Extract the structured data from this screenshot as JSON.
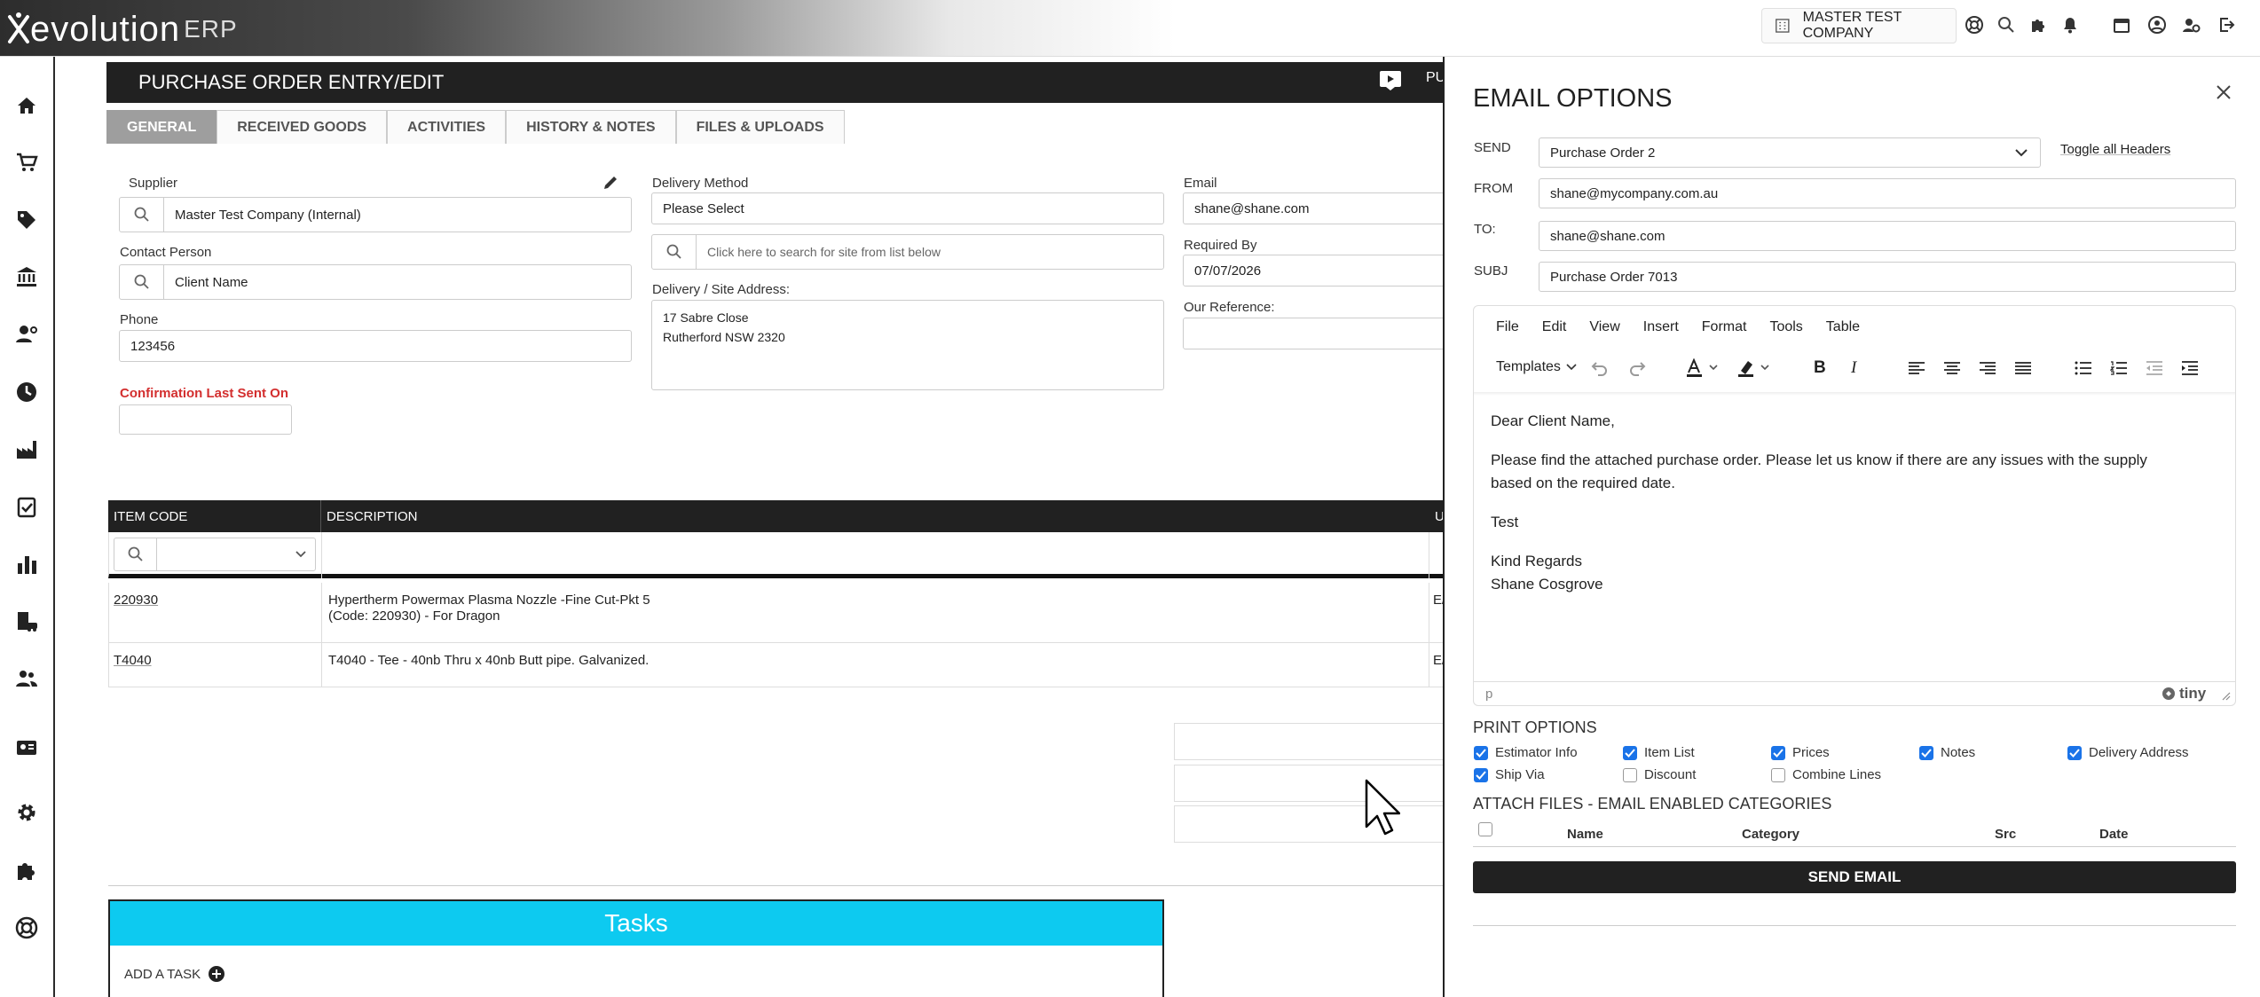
{
  "topbar": {
    "logo_text": "evolution",
    "logo_suffix": "ERP",
    "company": "MASTER TEST COMPANY"
  },
  "header": {
    "title": "PURCHASE ORDER ENTRY/EDIT",
    "right_text": "PU"
  },
  "tabs": [
    {
      "label": "GENERAL",
      "active": true
    },
    {
      "label": "RECEIVED GOODS"
    },
    {
      "label": "ACTIVITIES"
    },
    {
      "label": "HISTORY & NOTES"
    },
    {
      "label": "FILES & UPLOADS"
    }
  ],
  "form": {
    "supplier_label": "Supplier",
    "supplier_value": "Master Test Company (Internal)",
    "contact_label": "Contact Person",
    "contact_value": "Client Name",
    "phone_label": "Phone",
    "phone_value": "123456",
    "confirmation_label": "Confirmation Last Sent On",
    "confirmation_value": "",
    "delivery_method_label": "Delivery Method",
    "delivery_method_value": "Please Select",
    "site_search_placeholder": "Click here to search for site from list below",
    "delivery_address_label": "Delivery / Site Address:",
    "delivery_address_line1": "17 Sabre Close",
    "delivery_address_line2": "Rutherford NSW 2320",
    "email_label": "Email",
    "email_value": "shane@shane.com",
    "required_by_label": "Required By",
    "required_by_value": "07/07/2026",
    "our_ref_label": "Our Reference:",
    "our_ref_value": ""
  },
  "items": {
    "col_code": "ITEM CODE",
    "col_desc": "DESCRIPTION",
    "col_u": "U",
    "rows": [
      {
        "code": "220930",
        "desc1": "Hypertherm Powermax Plasma Nozzle -Fine Cut-Pkt 5",
        "desc2": "(Code: 220930) - For Dragon",
        "u": "E/"
      },
      {
        "code": "T4040",
        "desc1": "T4040 - Tee - 40nb Thru x 40nb Butt pipe. Galvanized.",
        "desc2": "",
        "u": "E/"
      }
    ]
  },
  "tasks": {
    "title": "Tasks",
    "add_label": "ADD A TASK"
  },
  "email": {
    "title": "EMAIL OPTIONS",
    "send_label": "SEND",
    "send_value": "Purchase Order 2",
    "toggle_headers": "Toggle all Headers",
    "from_label": "FROM",
    "from_value": "shane@mycompany.com.au",
    "to_label": "TO:",
    "to_value": "shane@shane.com",
    "subj_label": "SUBJ",
    "subj_value": "Purchase Order 7013",
    "menu": [
      "File",
      "Edit",
      "View",
      "Insert",
      "Format",
      "Tools",
      "Table"
    ],
    "templates_label": "Templates",
    "body": {
      "greeting": "Dear Client Name,",
      "para1_line1": "Please find the attached purchase order. Please let us know if there are any issues with the supply",
      "para1_line2": "based on the required date.",
      "para2": "Test",
      "closing1": "Kind Regards",
      "closing2": "Shane Cosgrove"
    },
    "statusbar_path": "p",
    "tiny_brand": "tiny",
    "print_options_title": "PRINT OPTIONS",
    "print_options": [
      {
        "label": "Estimator Info",
        "checked": true
      },
      {
        "label": "Item List",
        "checked": true
      },
      {
        "label": "Prices",
        "checked": true
      },
      {
        "label": "Notes",
        "checked": true
      },
      {
        "label": "Delivery Address",
        "checked": true
      },
      {
        "label": "Ship Via",
        "checked": true
      },
      {
        "label": "Discount",
        "checked": false
      },
      {
        "label": "Combine Lines",
        "checked": false
      }
    ],
    "attach_title": "ATTACH FILES - EMAIL ENABLED CATEGORIES",
    "attach_cols": {
      "name": "Name",
      "category": "Category",
      "src": "Src",
      "date": "Date"
    },
    "send_button": "SEND EMAIL"
  }
}
